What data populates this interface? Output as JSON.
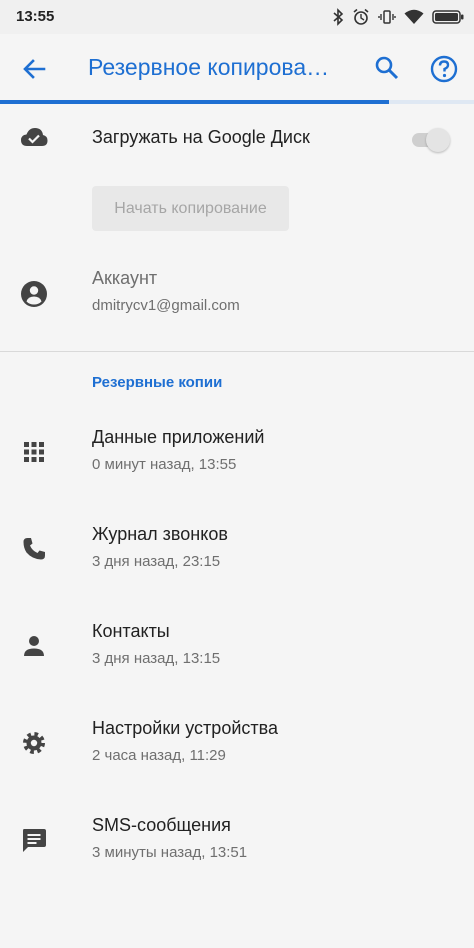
{
  "status_bar": {
    "time": "13:55",
    "icons": [
      "bluetooth-icon",
      "alarm-icon",
      "vibrate-icon",
      "wifi-icon",
      "battery-icon"
    ]
  },
  "app_bar": {
    "title": "Резервное копирова…",
    "back_icon": "arrow-back-icon",
    "search_icon": "search-icon",
    "help_icon": "help-icon"
  },
  "progress": {
    "fraction": 0.82
  },
  "colors": {
    "accent": "#1e6fd2",
    "background": "#f5f5f5"
  },
  "drive_backup": {
    "label": "Загружать на Google Диск",
    "icon": "cloud-done-icon",
    "toggle_on": false
  },
  "start_button": {
    "label": "Начать копирование",
    "enabled": false
  },
  "account": {
    "label": "Аккаунт",
    "email": "dmitrycv1@gmail.com",
    "icon": "account-circle-icon"
  },
  "backups": {
    "header": "Резервные копии",
    "items": [
      {
        "title": "Данные приложений",
        "subtitle": "0 минут назад, 13:55",
        "icon": "apps-grid-icon"
      },
      {
        "title": "Журнал звонков",
        "subtitle": "3 дня назад, 23:15",
        "icon": "phone-icon"
      },
      {
        "title": "Контакты",
        "subtitle": "3 дня назад, 13:15",
        "icon": "person-icon"
      },
      {
        "title": "Настройки устройства",
        "subtitle": "2 часа назад, 11:29",
        "icon": "settings-gear-icon"
      },
      {
        "title": "SMS-сообщения",
        "subtitle": "3 минуты назад, 13:51",
        "icon": "message-icon"
      }
    ]
  }
}
